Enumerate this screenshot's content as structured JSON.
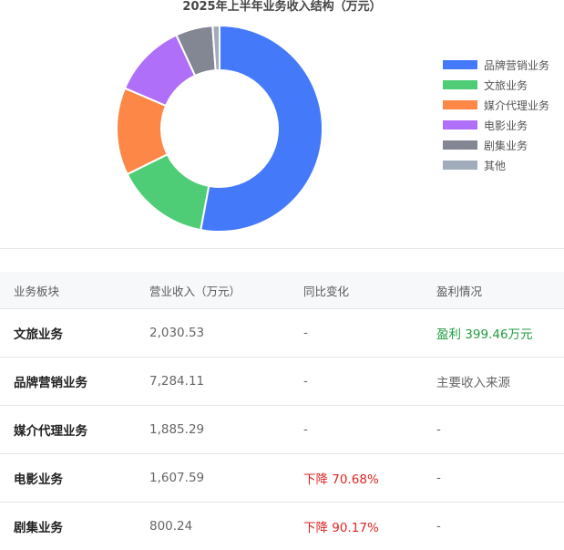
{
  "chart_data": {
    "type": "pie",
    "title": "2025年上半年业务收入结构（万元）",
    "donut": true,
    "legend_position": "right",
    "slices": [
      {
        "label": "品牌营销业务",
        "value": 7284.11,
        "color": "#4479fa"
      },
      {
        "label": "文旅业务",
        "value": 2030.53,
        "color": "#4ecd76"
      },
      {
        "label": "媒介代理业务",
        "value": 1885.29,
        "color": "#fd8746"
      },
      {
        "label": "电影业务",
        "value": 1607.59,
        "color": "#b06ff9"
      },
      {
        "label": "剧集业务",
        "value": 800.24,
        "color": "#838793"
      },
      {
        "label": "其他",
        "value": 150,
        "color": "#a1acbc"
      }
    ]
  },
  "table": {
    "headers": [
      "业务板块",
      "营业收入（万元）",
      "同比变化",
      "盈利情况"
    ],
    "rows": [
      {
        "name": "文旅业务",
        "revenue": "2,030.53",
        "yoy": "-",
        "profit": "盈利 399.46万元",
        "yoy_class": "",
        "profit_class": "green"
      },
      {
        "name": "品牌营销业务",
        "revenue": "7,284.11",
        "yoy": "-",
        "profit": "主要收入来源",
        "yoy_class": "",
        "profit_class": ""
      },
      {
        "name": "媒介代理业务",
        "revenue": "1,885.29",
        "yoy": "-",
        "profit": "-",
        "yoy_class": "",
        "profit_class": ""
      },
      {
        "name": "电影业务",
        "revenue": "1,607.59",
        "yoy": "下降 70.68%",
        "profit": "-",
        "yoy_class": "red",
        "profit_class": ""
      },
      {
        "name": "剧集业务",
        "revenue": "800.24",
        "yoy": "下降 90.17%",
        "profit": "-",
        "yoy_class": "red",
        "profit_class": ""
      }
    ]
  }
}
